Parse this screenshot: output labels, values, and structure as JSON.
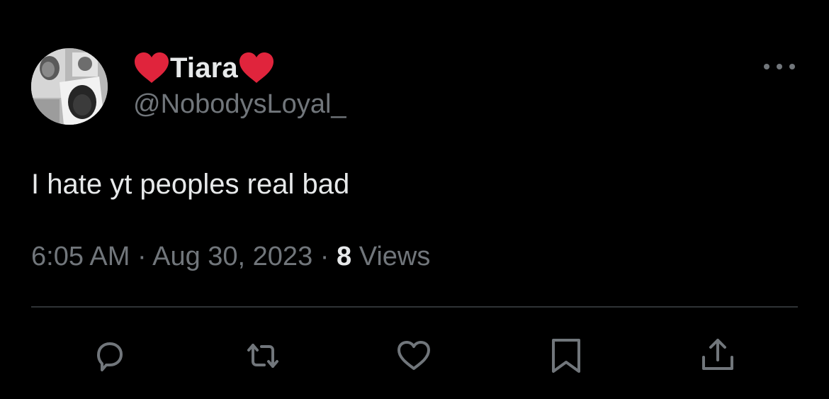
{
  "tweet": {
    "display_name": "Tiara",
    "handle": "@NobodysLoyal_",
    "text": "I hate yt peoples real bad",
    "time": "6:05 AM",
    "date": "Aug 30, 2023",
    "separator": "·",
    "views_count": "8",
    "views_label": "Views"
  },
  "icons": {
    "avatar": "profile-avatar",
    "name_decoration": "red-heart-emoji",
    "more": "more-horizontal-icon",
    "actions": [
      "reply-icon",
      "retweet-icon",
      "like-icon",
      "bookmark-icon",
      "share-icon"
    ]
  },
  "colors": {
    "background": "#000000",
    "primary_text": "#e7e9ea",
    "secondary_text": "#71767b",
    "heart": "#e0243c",
    "divider": "#2f3336"
  }
}
